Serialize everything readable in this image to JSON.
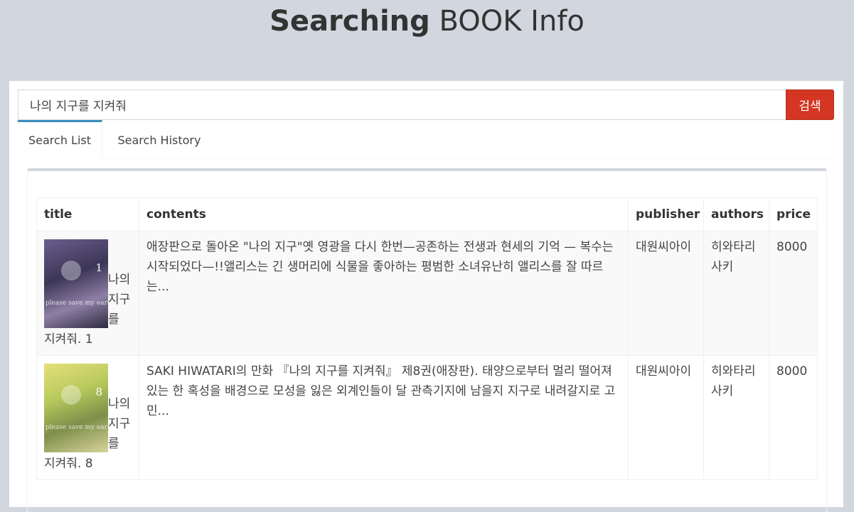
{
  "header": {
    "title_bold": "Searching",
    "title_rest": " BOOK Info"
  },
  "search": {
    "value": "나의 지구를 지켜줘",
    "button_label": "검색"
  },
  "tabs": [
    {
      "label": "Search List",
      "active": true
    },
    {
      "label": "Search History",
      "active": false
    }
  ],
  "table": {
    "columns": [
      "title",
      "contents",
      "publisher",
      "authors",
      "price"
    ],
    "rows": [
      {
        "title": "나의 지구를 지켜줘. 1",
        "contents": "애장판으로 돌아온 \"나의 지구\"옛 영광을 다시 한번—공존하는 전생과 현세의 기억 — 복수는 시작되었다—!!앨리스는 긴 생머리에 식물을 좋아하는 평범한 소녀유난히 앨리스를 잘 따르는...",
        "publisher": "대원씨아이",
        "authors": "히와타리 사키",
        "price": "8000",
        "cover_icon": "book-cover-image"
      },
      {
        "title": "나의 지구를 지켜줘. 8",
        "contents": "SAKI HIWATARI의 만화 『나의 지구를 지켜줘』 제8권(애장판). 태양으로부터 멀리 떨어져 있는 한 혹성을 배경으로 모성을 잃은 외계인들이 달 관측기지에 남을지 지구로 내려갈지로 고민...",
        "publisher": "대원씨아이",
        "authors": "히와타리 사키",
        "price": "8000",
        "cover_icon": "book-cover-image"
      }
    ]
  },
  "colors": {
    "background": "#d2d6de",
    "accent": "#3c8dbc",
    "button": "#d33724"
  }
}
